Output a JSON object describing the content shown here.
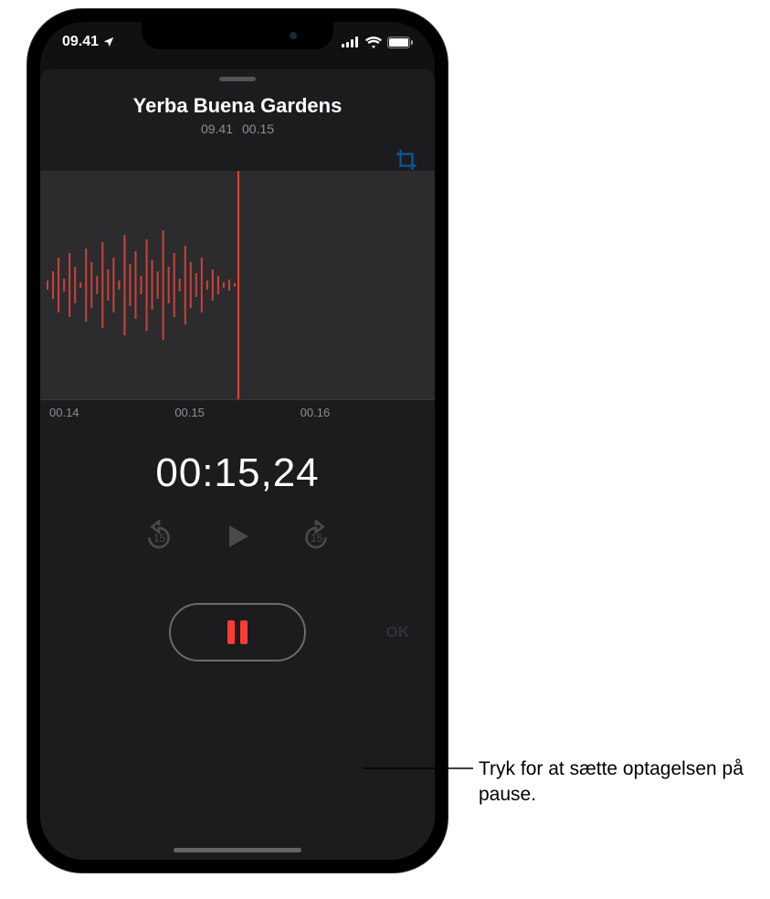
{
  "status": {
    "time": "09.41",
    "location_arrow": "▸"
  },
  "recording": {
    "title": "Yerba Buena Gardens",
    "time_label": "09.41",
    "duration_label": "00.15",
    "ruler": {
      "t1": "00.14",
      "t2": "00.15",
      "t3": "00.16"
    },
    "elapsed": "00:15,24",
    "done_label": "OK"
  },
  "callout": {
    "text": "Tryk for at sætte optagelsen på pause."
  }
}
